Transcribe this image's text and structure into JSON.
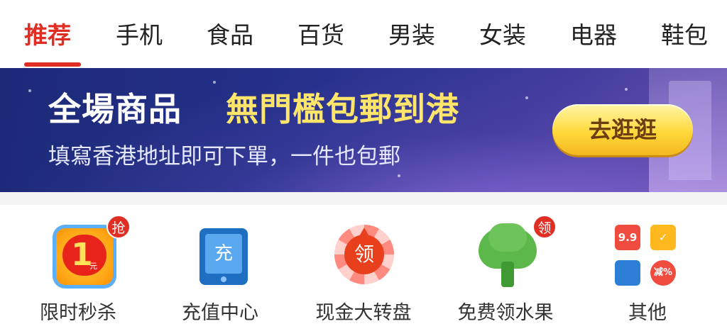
{
  "tabs": [
    {
      "label": "推荐",
      "active": true
    },
    {
      "label": "手机",
      "active": false
    },
    {
      "label": "食品",
      "active": false
    },
    {
      "label": "百货",
      "active": false
    },
    {
      "label": "男装",
      "active": false
    },
    {
      "label": "女装",
      "active": false
    },
    {
      "label": "电器",
      "active": false
    },
    {
      "label": "鞋包",
      "active": false
    }
  ],
  "banner": {
    "title_white": "全場商品",
    "title_yellow": "無門檻包郵到港",
    "subtitle": "填寫香港地址即可下單，一件也包郵",
    "button_label": "去逛逛"
  },
  "entries": [
    {
      "label": "限时秒杀",
      "icon": "flash-sale-icon",
      "badge": "抢",
      "icon_text": "1",
      "icon_subtext": "元"
    },
    {
      "label": "充值中心",
      "icon": "recharge-icon",
      "badge": "",
      "icon_text": "充"
    },
    {
      "label": "现金大转盘",
      "icon": "cash-wheel-icon",
      "badge": "",
      "icon_text": "领"
    },
    {
      "label": "免费领水果",
      "icon": "fruit-tree-icon",
      "badge": "领"
    },
    {
      "label": "其他",
      "icon": "more-grid-icon",
      "badge": "",
      "tiles": [
        "9.9",
        "✓",
        "",
        "减%"
      ]
    }
  ],
  "colors": {
    "accent": "#e02e24",
    "banner_bg": "#25318a",
    "banner_highlight": "#ffe66b",
    "button_yellow": "#ffd83a"
  }
}
